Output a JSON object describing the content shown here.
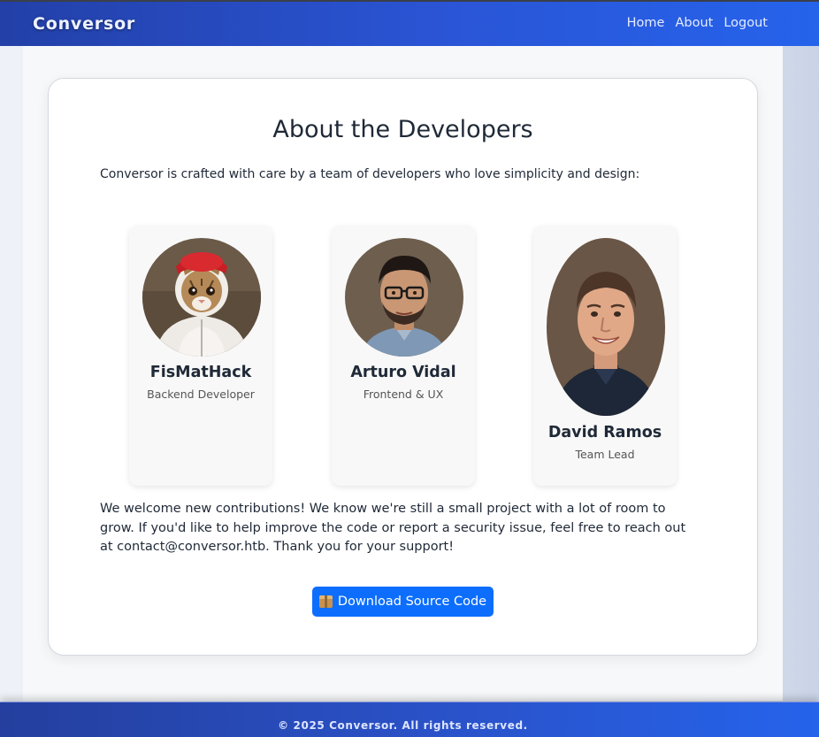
{
  "navbar": {
    "brand": "Conversor",
    "links": [
      "Home",
      "About",
      "Logout"
    ]
  },
  "main": {
    "title": "About the Developers",
    "intro": "Conversor is crafted with care by a team of developers who love simplicity and design:",
    "developers": [
      {
        "name": "FisMatHack",
        "role": "Backend Developer",
        "avatar_icon": "cat-in-hoodie-avatar"
      },
      {
        "name": "Arturo Vidal",
        "role": "Frontend & UX",
        "avatar_icon": "man-with-glasses-avatar"
      },
      {
        "name": "David Ramos",
        "role": "Team Lead",
        "avatar_icon": "smiling-man-avatar"
      }
    ],
    "outro": "We welcome new contributions! We know we're still a small project with a lot of room to grow. If you'd like to help improve the code or report a security issue, feel free to reach out at contact@conversor.htb. Thank you for your support!",
    "download_button": {
      "icon": "package-icon",
      "label": "Download Source Code"
    }
  },
  "footer": {
    "text": "© 2025 Conversor. All rights reserved."
  },
  "colors": {
    "nav_gradient_start": "#2340a8",
    "nav_gradient_end": "#2563eb",
    "button_primary": "#0d6efd",
    "card_background": "#ffffff"
  }
}
